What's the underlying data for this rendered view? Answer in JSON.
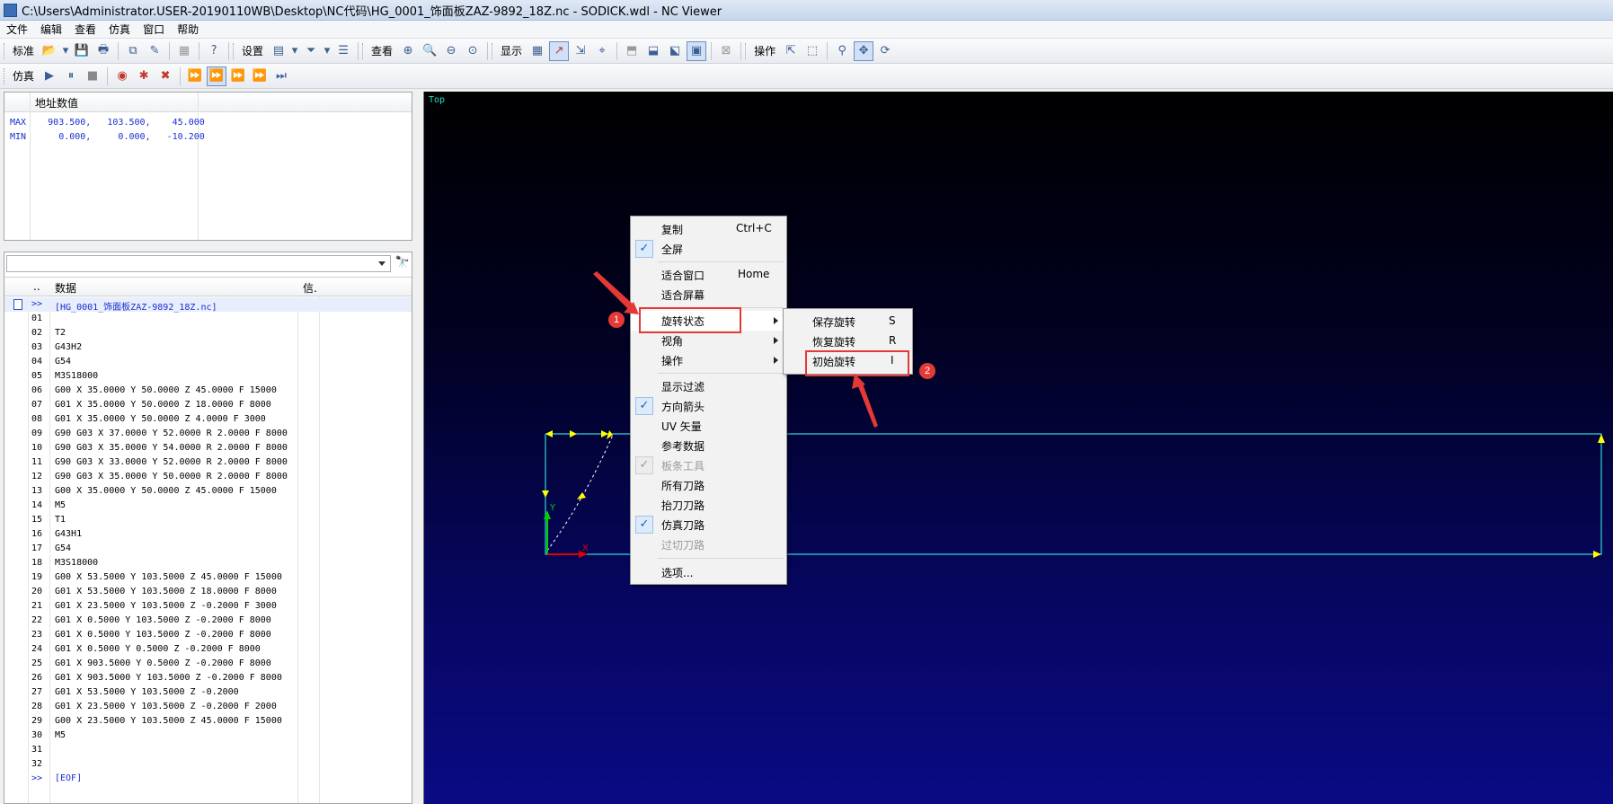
{
  "window": {
    "title": "C:\\Users\\Administrator.USER-20190110WB\\Desktop\\NC代码\\HG_0001_饰面板ZAZ-9892_18Z.nc - SODICK.wdl - NC Viewer"
  },
  "menubar": [
    "文件",
    "编辑",
    "查看",
    "仿真",
    "窗口",
    "帮助"
  ],
  "toolbar1": {
    "standard_label": "标准",
    "settings_label": "设置",
    "view_label": "查看",
    "display_label": "显示",
    "operate_label": "操作"
  },
  "toolbar2": {
    "simulate_label": "仿真"
  },
  "address_panel": {
    "header": "地址数值",
    "max_label": "MAX",
    "max_values": "903.500,   103.500,    45.000",
    "min_label": "MIN",
    "min_values": "  0.000,     0.000,   -10.200"
  },
  "code_panel": {
    "col_dots": "..",
    "col_data": "数据",
    "col_info": "信.",
    "file_marker": ">>",
    "file_line": "[HG_0001_饰面板ZAZ-9892_18Z.nc]",
    "lines": [
      {
        "n": "01",
        "t": ""
      },
      {
        "n": "02",
        "t": "T2"
      },
      {
        "n": "03",
        "t": "G43H2"
      },
      {
        "n": "04",
        "t": "G54"
      },
      {
        "n": "05",
        "t": "M3S18000"
      },
      {
        "n": "06",
        "t": "G00 X 35.0000 Y 50.0000 Z 45.0000 F 15000"
      },
      {
        "n": "07",
        "t": "G01 X 35.0000 Y 50.0000 Z 18.0000 F 8000"
      },
      {
        "n": "08",
        "t": "G01 X 35.0000 Y 50.0000 Z 4.0000 F 3000"
      },
      {
        "n": "09",
        "t": "G90 G03 X 37.0000 Y 52.0000 R 2.0000 F 8000"
      },
      {
        "n": "10",
        "t": "G90 G03 X 35.0000 Y 54.0000 R 2.0000 F 8000"
      },
      {
        "n": "11",
        "t": "G90 G03 X 33.0000 Y 52.0000 R 2.0000 F 8000"
      },
      {
        "n": "12",
        "t": "G90 G03 X 35.0000 Y 50.0000 R 2.0000 F 8000"
      },
      {
        "n": "13",
        "t": "G00 X 35.0000 Y 50.0000 Z 45.0000 F 15000"
      },
      {
        "n": "14",
        "t": "M5"
      },
      {
        "n": "15",
        "t": "T1"
      },
      {
        "n": "16",
        "t": "G43H1"
      },
      {
        "n": "17",
        "t": "G54"
      },
      {
        "n": "18",
        "t": "M3S18000"
      },
      {
        "n": "19",
        "t": "G00 X 53.5000 Y 103.5000 Z 45.0000 F 15000"
      },
      {
        "n": "20",
        "t": "G01 X 53.5000 Y 103.5000 Z 18.0000 F 8000"
      },
      {
        "n": "21",
        "t": "G01 X 23.5000 Y 103.5000 Z -0.2000 F 3000"
      },
      {
        "n": "22",
        "t": "G01 X 0.5000 Y 103.5000 Z -0.2000 F 8000"
      },
      {
        "n": "23",
        "t": "G01 X 0.5000 Y 103.5000 Z -0.2000 F 8000"
      },
      {
        "n": "24",
        "t": "G01 X 0.5000 Y 0.5000 Z -0.2000 F 8000"
      },
      {
        "n": "25",
        "t": "G01 X 903.5000 Y 0.5000 Z -0.2000 F 8000"
      },
      {
        "n": "26",
        "t": "G01 X 903.5000 Y 103.5000 Z -0.2000 F 8000"
      },
      {
        "n": "27",
        "t": "G01 X 53.5000 Y 103.5000 Z -0.2000"
      },
      {
        "n": "28",
        "t": "G01 X 23.5000 Y 103.5000 Z -0.2000 F 2000"
      },
      {
        "n": "29",
        "t": "G00 X 23.5000 Y 103.5000 Z 45.0000 F 15000"
      },
      {
        "n": "30",
        "t": "M5"
      },
      {
        "n": "31",
        "t": ""
      },
      {
        "n": "32",
        "t": ""
      }
    ],
    "eof_marker": ">>",
    "eof_line": "[EOF]"
  },
  "viewport": {
    "view_label": "Top",
    "axis_x": "X",
    "axis_y": "Y"
  },
  "context_menu": {
    "copy": "复制",
    "copy_key": "Ctrl+C",
    "fullscreen": "全屏",
    "fit_window": "适合窗口",
    "fit_window_key": "Home",
    "fit_screen": "适合屏幕",
    "rotate_state": "旋转状态",
    "view_angle": "视角",
    "operation": "操作",
    "display_filter": "显示过滤",
    "direction_arrow": "方向箭头",
    "uv_vector": "UV 矢量",
    "reference_data": "参考数据",
    "spline_tool": "板条工具",
    "all_toolpaths": "所有刀路",
    "lift_toolpaths": "抬刀刀路",
    "sim_toolpaths": "仿真刀路",
    "overcut_toolpaths": "过切刀路",
    "options": "选项...",
    "check_mark": "✓"
  },
  "submenu": {
    "save_rotation": "保存旋转",
    "save_rotation_key": "S",
    "restore_rotation": "恢复旋转",
    "restore_rotation_key": "R",
    "initial_rotation": "初始旋转",
    "initial_rotation_key": "I"
  },
  "annotations": {
    "badge1": "1",
    "badge2": "2"
  },
  "colors": {
    "toolpath": "#2fd6d6",
    "rapid": "#ffff00",
    "highlight_red": "#e53935",
    "code_blue": "#1a2fd0"
  }
}
